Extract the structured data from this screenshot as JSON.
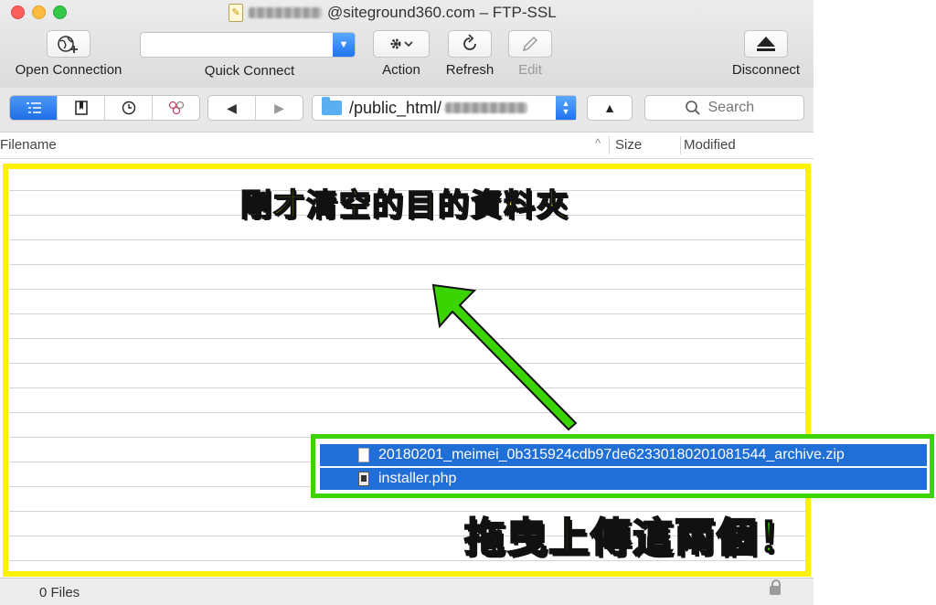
{
  "window": {
    "title_suffix": "@siteground360.com – FTP-SSL"
  },
  "toolbar": {
    "open_connection": "Open Connection",
    "quick_connect": "Quick Connect",
    "action": "Action",
    "refresh": "Refresh",
    "edit": "Edit",
    "disconnect": "Disconnect"
  },
  "navbar": {
    "path": "/public_html/",
    "search_placeholder": "Search"
  },
  "columns": {
    "filename": "Filename",
    "size": "Size",
    "modified": "Modified"
  },
  "overlay": {
    "caption_top": "剛才清空的目的資料夾",
    "caption_bottom": "拖曳上傳這兩個！",
    "frame_color": "#fff200",
    "accent_color": "#3cd400"
  },
  "drag_files": [
    {
      "name": "20180201_meimei_0b315924cdb97de62330180201081544_archive.zip",
      "icon": "document-icon"
    },
    {
      "name": "installer.php",
      "icon": "php-file-icon"
    }
  ],
  "status": {
    "file_count": "0 Files"
  }
}
